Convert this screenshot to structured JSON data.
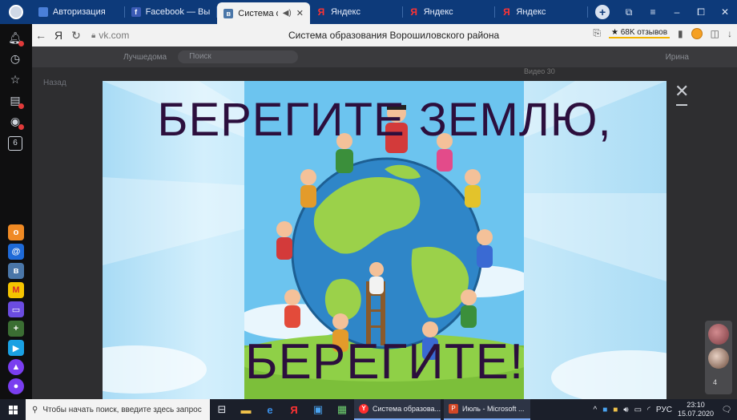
{
  "tabs": [
    {
      "title": "Авторизация",
      "icon": "auth-page-icon",
      "active": false
    },
    {
      "title": "Facebook — Выполн",
      "icon": "facebook-icon",
      "active": false
    },
    {
      "title": "Система обра",
      "icon": "vk-icon",
      "active": true
    },
    {
      "title": "Яндекс",
      "icon": "yandex-icon",
      "active": false
    },
    {
      "title": "Яндекс",
      "icon": "yandex-icon",
      "active": false
    },
    {
      "title": "Яндекс",
      "icon": "yandex-icon",
      "active": false
    }
  ],
  "address": {
    "url": "vk.com",
    "page_title": "Система образования Ворошиловского района",
    "reviews": "★ 68K отзывов"
  },
  "sidebar": {
    "tabs_count": "6"
  },
  "vk": {
    "site_name": "Лучшедома",
    "search_placeholder": "Поиск",
    "user_name": "Ирина",
    "back_label": "Назад",
    "video_label": "Видео 30"
  },
  "poster": {
    "headline": "БЕРЕГИТЕ ЗЕМЛЮ,",
    "footline": "БЕРЕГИТЕ!"
  },
  "chat": {
    "count": "4"
  },
  "taskbar": {
    "search_placeholder": "Чтобы начать поиск, введите здесь запрос",
    "app1": "Система образова...",
    "app2": "Июль - Microsoft ...",
    "lang": "РУС",
    "time": "23:10",
    "date": "15.07.2020"
  },
  "colors": {
    "tabbar": "#0d3a7a",
    "headline": "#2c0f3d",
    "taskbar": "#1b1f2a"
  }
}
